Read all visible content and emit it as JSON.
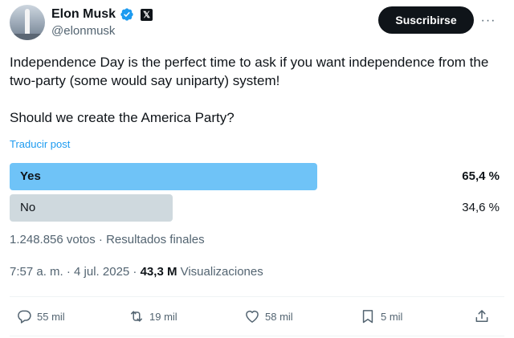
{
  "user": {
    "name": "Elon Musk",
    "handle": "@elonmusk",
    "badge_glyph": "𝕏"
  },
  "subscribe_label": "Suscribirse",
  "more_label": "···",
  "tweet": {
    "paragraph1": "Independence Day is the perfect time to ask if you want independence from the two-party (some would say uniparty) system!",
    "paragraph2": "Should we create the America Party?"
  },
  "translate_label": "Traducir post",
  "poll": {
    "options": [
      {
        "label": "Yes",
        "percent_text": "65,4 %",
        "percent": 65.4,
        "winner": true,
        "color": "#6fc3f7"
      },
      {
        "label": "No",
        "percent_text": "34,6 %",
        "percent": 34.6,
        "winner": false,
        "color": "#cfd9de"
      }
    ],
    "meta": "1.248.856 votos · Resultados finales"
  },
  "timestamp": {
    "time": "7:57 a. m. · 4 jul. 2025 · ",
    "views_count": "43,3 M",
    "views_label": " Visualizaciones"
  },
  "actions": {
    "replies": "55 mil",
    "reposts": "19 mil",
    "likes": "58 mil",
    "bookmarks": "5 mil"
  },
  "icons": [
    "verified-icon",
    "reply-icon",
    "repost-icon",
    "like-icon",
    "bookmark-icon",
    "share-icon",
    "more-icon"
  ]
}
